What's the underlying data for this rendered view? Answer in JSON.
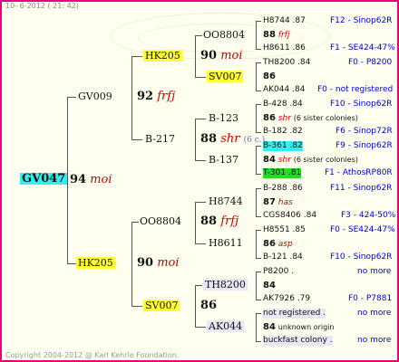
{
  "header": {
    "date": "10- 6-2012 ( 21: 42)"
  },
  "footer": {
    "copyright": "Copyright 2004-2012 @ Karl Kehrle Foundation."
  },
  "root": {
    "name": "GV047",
    "num": "94",
    "tag": "moi"
  },
  "gen1": {
    "sire": {
      "name": "GV009",
      "num": "92",
      "tag": "frfj"
    },
    "dam": {
      "name": "HK205",
      "num": "90",
      "tag": "moi"
    }
  },
  "gen2": {
    "a": {
      "name": "HK205",
      "num": "90",
      "tag": "moi"
    },
    "b": {
      "name": "B-217",
      "num": "88",
      "tag": "shr",
      "extra": "(6 c.)"
    },
    "c": {
      "name": "OO8804",
      "num": "88",
      "tag": "frfj"
    },
    "d": {
      "name": "SV007",
      "num": "86",
      "tag": ""
    }
  },
  "gen3": {
    "a1": "OO8804",
    "a2": "SV007",
    "b1": "B-123",
    "b2": "B-137",
    "c1": "H8744",
    "c2": "H8611",
    "d1": "TH8200",
    "d2": "AK044"
  },
  "gen4": [
    {
      "top": "H8744 .87",
      "top_right": "F12 - Sinop62R",
      "mid_num": "88",
      "mid_tag": "frfj",
      "mid_extra": "",
      "mid_right": "",
      "bot": "H8611 .86",
      "bot_right": "F1 - SE424-47%"
    },
    {
      "top": "TH8200 .84",
      "top_right": "F0 - P8200",
      "mid_num": "86",
      "mid_tag": "",
      "mid_extra": "",
      "mid_right": "",
      "bot": "AK044 .84",
      "bot_right": "F0 - not registered"
    },
    {
      "top": "B-428 .84",
      "top_right": "F10 - Sinop62R",
      "mid_num": "86",
      "mid_tag": "shr",
      "mid_extra": "(6 sister colonies)",
      "mid_right": "",
      "bot": "B-182 .82",
      "bot_right": "F6 - Sinop72R"
    },
    {
      "top": "B-361 .82",
      "top_right": "F9 - Sinop62R",
      "mid_num": "84",
      "mid_tag": "shr",
      "mid_extra": "(6 sister colonies)",
      "mid_right": "",
      "bot": "T-301 .81",
      "bot_right": "F1 - AthosRP80R"
    },
    {
      "top": "B-288 .86",
      "top_right": "F11 - Sinop62R",
      "mid_num": "87",
      "mid_tag": "has",
      "mid_extra": "",
      "mid_right": "",
      "bot": "CGS8406 .84",
      "bot_right": "F3 - 424-50%"
    },
    {
      "top": "H8551 .85",
      "top_right": "F0 - SE424-47%",
      "mid_num": "86",
      "mid_tag": "asp",
      "mid_extra": "",
      "mid_right": "",
      "bot": "B-121 .84",
      "bot_right": "F10 - Sinop62R"
    },
    {
      "top": "P8200 .",
      "top_right": "no more",
      "mid_num": "84",
      "mid_tag": "",
      "mid_extra": "",
      "mid_right": "",
      "bot": "AK7926 .79",
      "bot_right": "F0 - P7881"
    },
    {
      "top": "not registered .",
      "top_right": "no more",
      "mid_num": "84",
      "mid_tag": "",
      "mid_extra": "unknown origin",
      "mid_right": "",
      "bot": "buckfast colony .",
      "bot_right": "no more"
    }
  ]
}
